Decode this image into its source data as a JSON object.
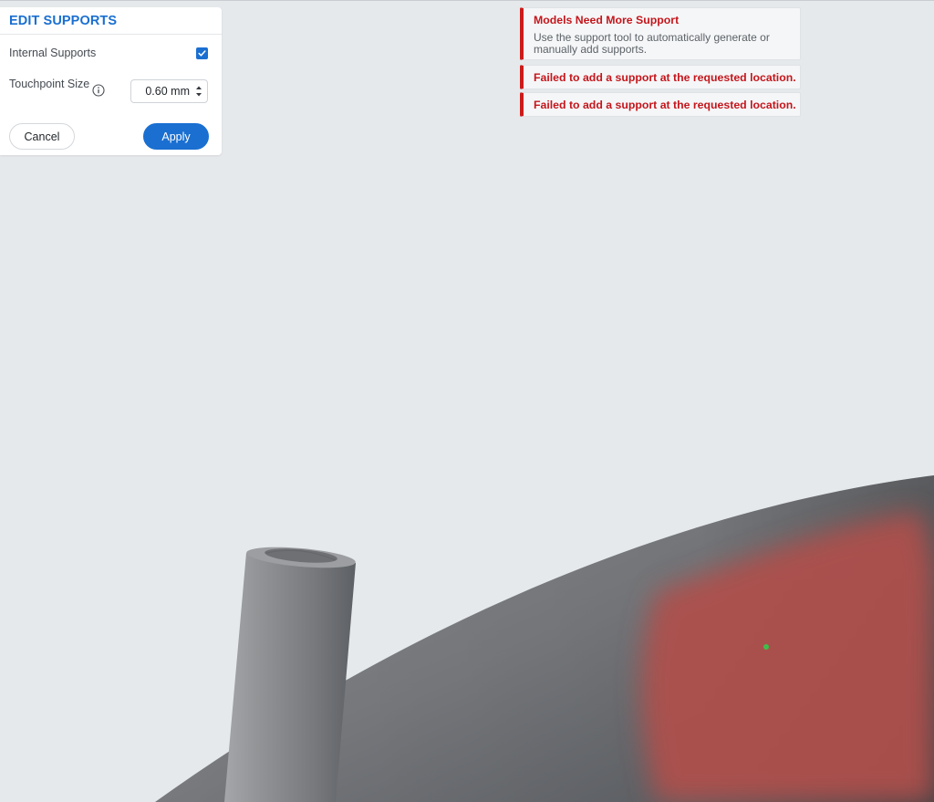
{
  "panel": {
    "title": "EDIT SUPPORTS",
    "internal_supports_label": "Internal Supports",
    "internal_supports_checked": true,
    "touchpoint_size_label": "Touchpoint Size",
    "touchpoint_size_value": "0.60 mm",
    "cancel_label": "Cancel",
    "apply_label": "Apply"
  },
  "notifications": [
    {
      "title": "Models Need More Support",
      "body": "Use the support tool to automatically generate or manually add supports."
    },
    {
      "title": "Failed to add a support at the requested location."
    },
    {
      "title": "Failed to add a support at the requested location."
    }
  ],
  "colors": {
    "accent": "#1a6fd1",
    "error": "#cc1b1b",
    "background": "#e6e9ec",
    "model": "#7d7f83",
    "overhang": "#b2504d",
    "touchpoint": "#3fbf4a"
  },
  "icons": {
    "checkbox": "checkmark-icon",
    "info": "info-icon",
    "stepper": "up-down-arrows-icon"
  }
}
